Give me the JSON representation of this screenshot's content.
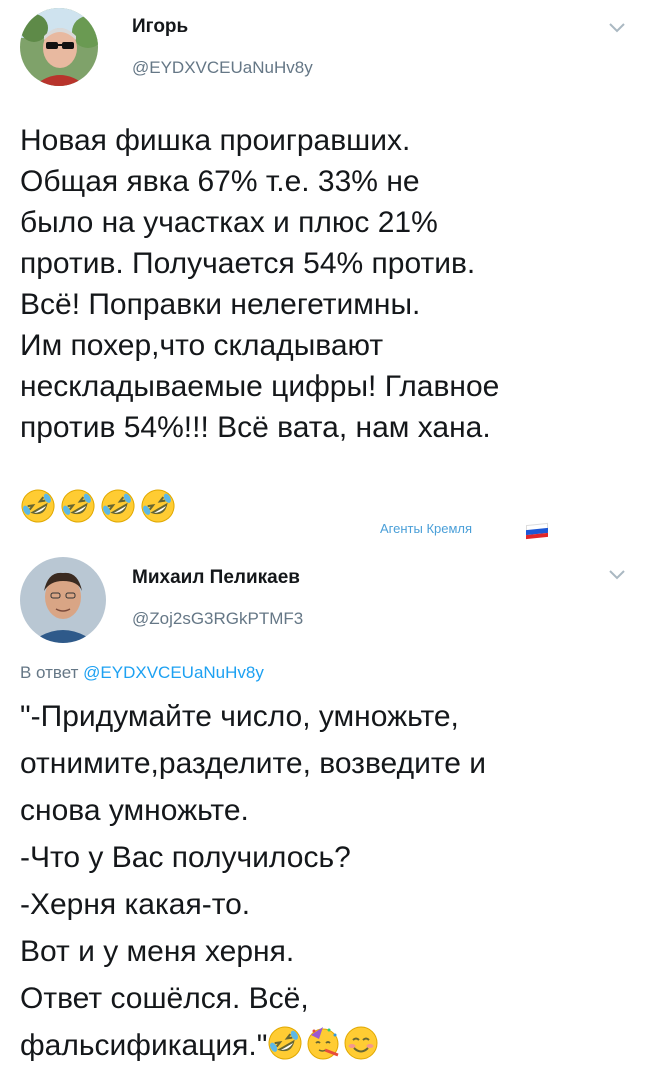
{
  "tweets": [
    {
      "author": {
        "name": "Игорь",
        "handle": "@EYDXVCEUaNuHv8y",
        "avatar": "man-with-sunglasses-avatar"
      },
      "text": "Новая фишка проигравших.\nОбщая явка 67% т.е. 33% не\nбыло на участках и плюс 21%\nпротив. Получается 54% против.\nВсё! Поправки нелегетимны.\nИм похер,что складывают\nнескладываемые цифры! Главное\nпротив 54%!!! Всё вата, нам хана.",
      "emojis": [
        "rolling-on-floor-laughing",
        "rolling-on-floor-laughing",
        "rolling-on-floor-laughing",
        "rolling-on-floor-laughing"
      ],
      "menu_icon": "chevron-down-icon"
    },
    {
      "author": {
        "name": "Михаил Пеликаев",
        "handle": "@Zoj2sG3RGkPTMF3",
        "avatar": "man-portrait-avatar"
      },
      "reply_prefix": "В ответ ",
      "reply_handle": "@EYDXVCEUaNuHv8y",
      "text": "\"-Придумайте число, умножьте,\nотнимите,разделите, возведите и\nснова умножьте.\n -Что у Вас получилось?\n-Херня какая-то.\nВот и у меня херня.\nОтвет сошёлся. Всё,\nфальсификация.\"",
      "emojis": [
        "rolling-on-floor-laughing",
        "face-with-party-horn",
        "smiling-face-with-smiling-eyes"
      ],
      "menu_icon": "chevron-down-icon"
    }
  ],
  "watermark": {
    "text": "Агенты Кремля",
    "flag_colors": [
      "#ffffff",
      "#1c57d6",
      "#e0262b"
    ]
  },
  "colors": {
    "text": "#14171a",
    "secondary": "#657786",
    "link": "#1da1f2",
    "emoji_yellow": "#ffcc33"
  }
}
